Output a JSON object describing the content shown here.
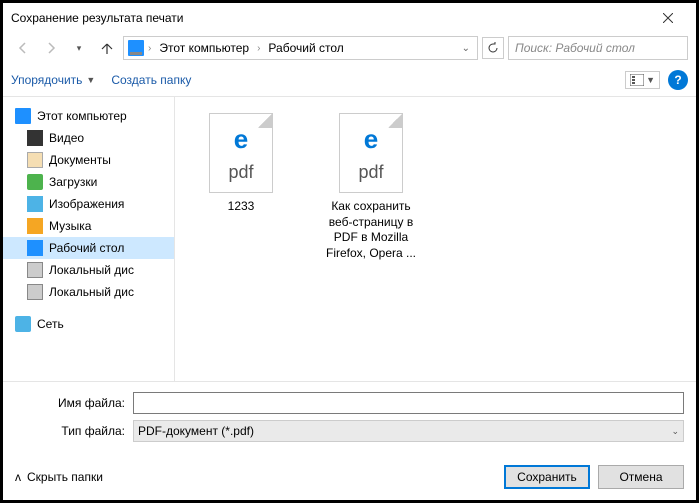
{
  "window": {
    "title": "Сохранение результата печати"
  },
  "breadcrumb": {
    "root": "Этот компьютер",
    "current": "Рабочий стол"
  },
  "search": {
    "placeholder": "Поиск: Рабочий стол"
  },
  "toolbar": {
    "organize": "Упорядочить",
    "newfolder": "Создать папку"
  },
  "tree": {
    "pc": "Этот компьютер",
    "items": [
      {
        "label": "Видео"
      },
      {
        "label": "Документы"
      },
      {
        "label": "Загрузки"
      },
      {
        "label": "Изображения"
      },
      {
        "label": "Музыка"
      },
      {
        "label": "Рабочий стол"
      },
      {
        "label": "Локальный дис"
      },
      {
        "label": "Локальный дис"
      }
    ],
    "network": "Сеть"
  },
  "files": [
    {
      "name": "1233",
      "ext": "pdf"
    },
    {
      "name": "Как сохранить веб-страницу в PDF в Mozilla Firefox, Opera ...",
      "ext": "pdf"
    }
  ],
  "form": {
    "name_label": "Имя файла:",
    "name_value": "",
    "type_label": "Тип файла:",
    "type_value": "PDF-документ (*.pdf)"
  },
  "footer": {
    "hide": "Скрыть папки",
    "save": "Сохранить",
    "cancel": "Отмена"
  }
}
